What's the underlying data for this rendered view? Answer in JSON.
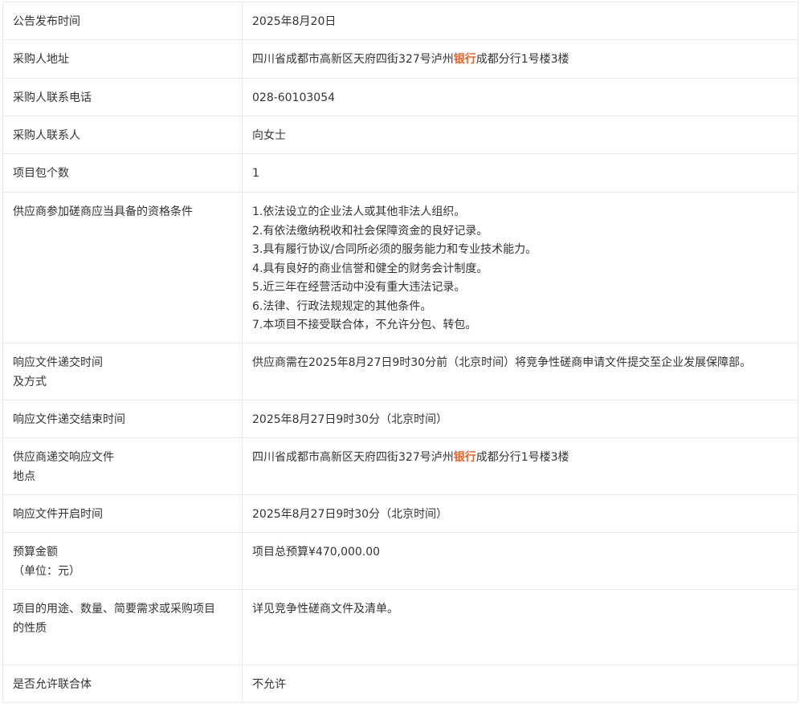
{
  "rows": [
    {
      "label": [
        "公告发布时间"
      ],
      "value": [
        "2025年8月20日"
      ]
    },
    {
      "label": [
        "采购人地址"
      ],
      "value_parts": [
        "四川省成都市高新区天府四街327号泸州",
        "银行",
        "成都分行1号楼3楼"
      ]
    },
    {
      "label": [
        "采购人联系电话"
      ],
      "value": [
        "028-60103054"
      ]
    },
    {
      "label": [
        "采购人联系人"
      ],
      "value": [
        "向女士"
      ]
    },
    {
      "label": [
        "项目包个数"
      ],
      "value": [
        "1"
      ]
    },
    {
      "label": [
        "供应商参加磋商应当具备的资格条件"
      ],
      "value": [
        "1.依法设立的企业法人或其他非法人组织。",
        "2.有依法缴纳税收和社会保障资金的良好记录。",
        "3.具有履行协议/合同所必须的服务能力和专业技术能力。",
        "4.具有良好的商业信誉和健全的财务会计制度。",
        "5.近三年在经营活动中没有重大违法记录。",
        "6.法律、行政法规规定的其他条件。",
        "7.本项目不接受联合体，不允许分包、转包。"
      ]
    },
    {
      "label": [
        "响应文件递交时间",
        "及方式"
      ],
      "value": [
        "供应商需在2025年8月27日9时30分前（北京时间）将竞争性磋商申请文件提交至企业发展保障部。"
      ]
    },
    {
      "label": [
        "响应文件递交结束时间"
      ],
      "value": [
        "2025年8月27日9时30分（北京时间）"
      ]
    },
    {
      "label": [
        "供应商递交响应文件",
        "地点"
      ],
      "value_parts": [
        "四川省成都市高新区天府四街327号泸州",
        "银行",
        "成都分行1号楼3楼"
      ]
    },
    {
      "label": [
        "响应文件开启时间"
      ],
      "value": [
        "2025年8月27日9时30分（北京时间）"
      ]
    },
    {
      "label": [
        "预算金额",
        "（单位：元）"
      ],
      "value": [
        "项目总预算¥470,000.00"
      ]
    },
    {
      "label": [
        "项目的用途、数量、简要需求或采购项目",
        "的性质"
      ],
      "value": [
        "详见竞争性磋商文件及清单。"
      ]
    },
    {
      "label": [
        "是否允许联合体"
      ],
      "value": [
        "不允许"
      ]
    }
  ]
}
